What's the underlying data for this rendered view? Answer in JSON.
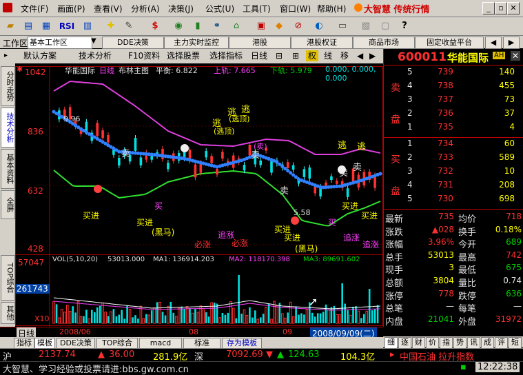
{
  "menu": {
    "items": [
      "文件(F)",
      "画面(P)",
      "查看(V)",
      "分析(A)",
      "决策(J)",
      "公式(U)",
      "工具(T)",
      "窗口(W)",
      "帮助(H)"
    ],
    "brand": "大智慧 传统行情"
  },
  "tabs": {
    "workarea_label": "工作区",
    "workarea_value": "基本工作区",
    "items": [
      "DDE决策",
      "主力实时监控",
      "港股",
      "港股权证",
      "商品市场",
      "固定收益平台"
    ]
  },
  "chart_toolbar": {
    "items": [
      "默认方案",
      "技术分析",
      "F10资料",
      "选择股票",
      "选择指标",
      "日线"
    ],
    "buttons": [
      "权",
      "线",
      "移"
    ]
  },
  "left_tabs": [
    "分时走势",
    "技术分析",
    "基本资料",
    "全屏",
    "TOP综合",
    "其他"
  ],
  "main_chart": {
    "header_name": "华能国际",
    "header_period": "日线",
    "header_indicator": "布林主图",
    "header_balance": "平衡: 6.822",
    "header_upper": "上轨: 7.665",
    "header_lower": "下轨: 5.979",
    "header_rest": "0.000, 0.000, 0.000",
    "y_labels": [
      "1042",
      "836",
      "632",
      "428"
    ],
    "annotations": {
      "high_label": "9.96",
      "low_label": "5.58",
      "buy_in": "买进",
      "black_horse": "(黑马)",
      "buy": "买",
      "sell": "卖",
      "must_rise": "必涨",
      "chase_rise": "追涨",
      "escape": "逃",
      "escape_top": "(逃顶)",
      "sell_paren": "(卖)"
    }
  },
  "volume_chart": {
    "header": "VOL(5,10,20)",
    "vol_value": "53013.000",
    "ma1": "MA1: 136914.203",
    "ma2": "MA2: 118170.398",
    "ma3": "MA3: 89691.602",
    "y_top": "57047",
    "y_mid": "261743",
    "y_bottom": "X10",
    "x_labels": [
      "2008/06",
      "08",
      "09"
    ],
    "date_box": "2008/09/09(二)",
    "period": "日线"
  },
  "right_panel": {
    "code": "600011",
    "name": "华能国际",
    "badge": "AH",
    "sell_label": "卖盘",
    "buy_label": "买盘",
    "sell_levels": [
      {
        "level": "5",
        "price": "739",
        "vol": "140"
      },
      {
        "level": "4",
        "price": "738",
        "vol": "455"
      },
      {
        "level": "3",
        "price": "737",
        "vol": "73"
      },
      {
        "level": "2",
        "price": "736",
        "vol": "37"
      },
      {
        "level": "1",
        "price": "735",
        "vol": "4"
      }
    ],
    "buy_levels": [
      {
        "level": "1",
        "price": "734",
        "vol": "60"
      },
      {
        "level": "2",
        "price": "733",
        "vol": "589"
      },
      {
        "level": "3",
        "price": "732",
        "vol": "10"
      },
      {
        "level": "4",
        "price": "731",
        "vol": "208"
      },
      {
        "level": "5",
        "price": "730",
        "vol": "698"
      }
    ],
    "stats": [
      {
        "k1": "最新",
        "v1": "735",
        "c1": "red",
        "k2": "均价",
        "v2": "718",
        "c2": "red"
      },
      {
        "k1": "涨跌",
        "v1": "▲028",
        "c1": "red",
        "k2": "换手",
        "v2": "0.18%",
        "c2": "yellow"
      },
      {
        "k1": "涨幅",
        "v1": "3.96%",
        "c1": "red",
        "k2": "今开",
        "v2": "689",
        "c2": "green"
      },
      {
        "k1": "总手",
        "v1": "53013",
        "c1": "yellow",
        "k2": "最高",
        "v2": "742",
        "c2": "red"
      },
      {
        "k1": "现手",
        "v1": "3",
        "c1": "yellow",
        "k2": "最低",
        "v2": "675",
        "c2": "green"
      },
      {
        "k1": "总额",
        "v1": "3804",
        "c1": "yellow",
        "k2": "量比",
        "v2": "0.74",
        "c2": "white"
      },
      {
        "k1": "涨停",
        "v1": "778",
        "c1": "red",
        "k2": "跌停",
        "v2": "636",
        "c2": "green"
      },
      {
        "k1": "总笔",
        "v1": "—",
        "c1": "white",
        "k2": "每笔",
        "v2": "—",
        "c2": "white"
      },
      {
        "k1": "内盘",
        "v1": "21041",
        "c1": "green",
        "k2": "外盘",
        "v2": "31972",
        "c2": "red"
      }
    ],
    "bottom_tabs": [
      "细",
      "逐",
      "财",
      "价",
      "指",
      "势",
      "讯",
      "成",
      "评",
      "短"
    ]
  },
  "bottom_tabs": [
    "指标",
    "模板",
    "DDE决策",
    "TOP综合",
    "macd",
    "标准",
    "存为模板"
  ],
  "status": {
    "sh_label": "沪",
    "sh_index": "2137.74",
    "sh_change": "36.00",
    "sh_amount": "281.9亿",
    "sz_label": "深",
    "sz_index": "7092.69",
    "sz_change": "124.63",
    "sz_amount": "104.3亿",
    "ticker": "中国石油 拉升指数",
    "contact": "大智慧、学习经验或投票请进:bbs.gw.com.cn",
    "time": "12:22:38"
  },
  "colors": {
    "up": "#ff3030",
    "down": "#00d000",
    "upper_band": "#e040e0",
    "lower_band": "#30e030",
    "mid_band": "#3080ff",
    "label_yellow": "#ffff00"
  }
}
